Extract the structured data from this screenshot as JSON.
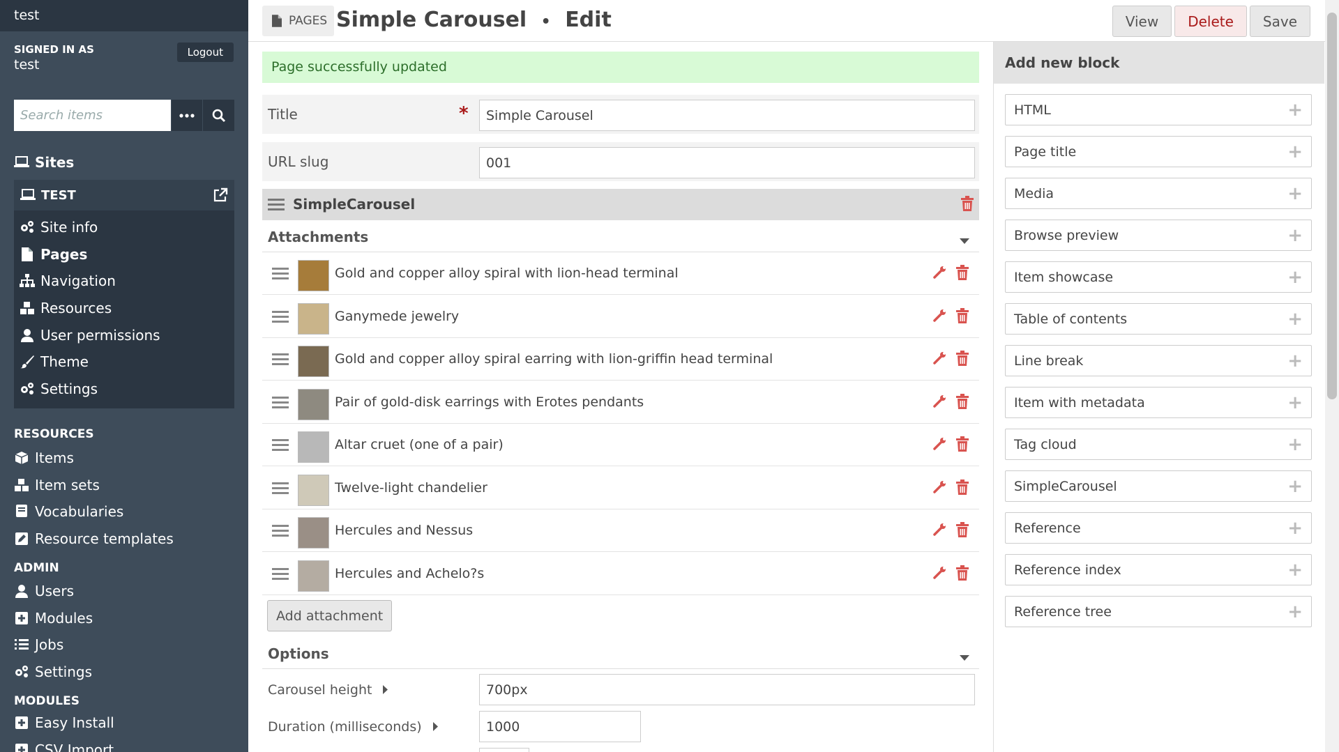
{
  "sidebar": {
    "install_name": "test",
    "signed_in_label": "SIGNED IN AS",
    "username": "test",
    "logout_label": "Logout",
    "search_placeholder": "Search items",
    "sites_label": "Sites",
    "site_name": "TEST",
    "site_items": [
      {
        "label": "Site info",
        "icon": "gears-icon"
      },
      {
        "label": "Pages",
        "icon": "file-icon"
      },
      {
        "label": "Navigation",
        "icon": "sitemap-icon"
      },
      {
        "label": "Resources",
        "icon": "cubes-icon"
      },
      {
        "label": "User permissions",
        "icon": "user-icon"
      },
      {
        "label": "Theme",
        "icon": "brush-icon"
      },
      {
        "label": "Settings",
        "icon": "gears-icon"
      }
    ],
    "resources_heading": "RESOURCES",
    "resources": [
      {
        "label": "Items",
        "icon": "cube-icon"
      },
      {
        "label": "Item sets",
        "icon": "cubes-icon"
      },
      {
        "label": "Vocabularies",
        "icon": "book-icon"
      },
      {
        "label": "Resource templates",
        "icon": "edit-icon"
      }
    ],
    "admin_heading": "ADMIN",
    "admin": [
      {
        "label": "Users",
        "icon": "user-icon"
      },
      {
        "label": "Modules",
        "icon": "plus-square-icon"
      },
      {
        "label": "Jobs",
        "icon": "tasks-icon"
      },
      {
        "label": "Settings",
        "icon": "gears-icon"
      }
    ],
    "modules_heading": "MODULES",
    "modules": [
      {
        "label": "Easy Install",
        "icon": "plus-square-icon"
      },
      {
        "label": "CSV Import",
        "icon": "plus-square-icon"
      }
    ]
  },
  "header": {
    "breadcrumb": "PAGES",
    "page_name": "Simple Carousel",
    "separator": "•",
    "mode": "Edit",
    "view_label": "View",
    "delete_label": "Delete",
    "save_label": "Save"
  },
  "main": {
    "flash": "Page successfully updated",
    "title_label": "Title",
    "required_mark": "*",
    "title_value": "Simple Carousel",
    "slug_label": "URL slug",
    "slug_value": "001",
    "block_name": "SimpleCarousel",
    "attachments_heading": "Attachments",
    "attachments": [
      "Gold and copper alloy spiral with lion-head terminal",
      "Ganymede jewelry",
      "Gold and copper alloy spiral earring with lion-griffin head terminal",
      "Pair of gold-disk earrings with Erotes pendants",
      "Altar cruet (one of a pair)",
      "Twelve-light chandelier",
      "Hercules and Nessus",
      "Hercules and Achelo?s"
    ],
    "add_attachment_label": "Add attachment",
    "options_heading": "Options",
    "options": [
      {
        "label": "Carousel height",
        "value": "700px"
      },
      {
        "label": "Duration (milliseconds)",
        "value": "1000"
      }
    ]
  },
  "right_panel": {
    "heading": "Add new block",
    "blocks": [
      "HTML",
      "Page title",
      "Media",
      "Browse preview",
      "Item showcase",
      "Table of contents",
      "Line break",
      "Item with metadata",
      "Tag cloud",
      "SimpleCarousel",
      "Reference",
      "Reference index",
      "Reference tree"
    ],
    "add_symbol": "+"
  },
  "colors": {
    "sidebar_bg": "#3e4c5a",
    "sidebar_dark": "#2b3642",
    "danger": "#a91919",
    "success_bg": "#d8fad6",
    "action_icon": "#d9534f"
  }
}
